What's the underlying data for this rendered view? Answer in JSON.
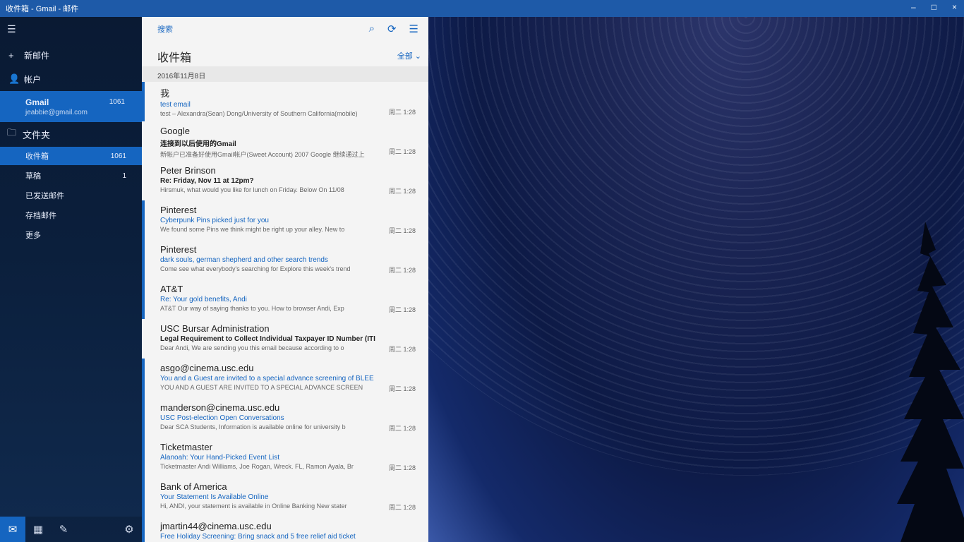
{
  "titlebar": {
    "title": "收件箱 - Gmail - 邮件",
    "controls": [
      "–",
      "□",
      "×"
    ]
  },
  "nav": {
    "menu_icon": "hamburger-icon",
    "new_mail": "新邮件",
    "accounts": "帐户",
    "account": {
      "name": "Gmail",
      "email": "jeabbie@gmail.com",
      "count": "1061"
    },
    "folders_header": "文件夹",
    "folders": [
      {
        "label": "收件箱",
        "count": "1061",
        "active": true
      },
      {
        "label": "草稿",
        "count": "1",
        "active": false
      },
      {
        "label": "已发送邮件",
        "count": "",
        "active": false
      },
      {
        "label": "存档邮件",
        "count": "",
        "active": false
      },
      {
        "label": "更多",
        "count": "",
        "active": false
      }
    ],
    "bottom_icons": [
      "mail-icon",
      "calendar-icon",
      "people-icon",
      "settings-icon"
    ]
  },
  "list": {
    "toolbar_label": "搜索",
    "title": "收件箱",
    "filter": "全部",
    "date_header": "2016年11月8日",
    "messages": [
      {
        "sender": "我",
        "subject": "test email",
        "preview": "test – Alexandra(Sean) Dong/University of Southern California(mobile)",
        "time": "周二 1:28",
        "unread": true
      },
      {
        "sender": "Google",
        "subject": "连接到以后使用的Gmail",
        "preview": "新帐户已准备好使用Gmail帐户(Sweet Account) 2007 Google 继续通过上",
        "time": "周二 1:28",
        "unread": false
      },
      {
        "sender": "Peter Brinson",
        "subject": "Re: Friday, Nov 11 at 12pm?",
        "preview": "Hirsmuk, what would you like for lunch on Friday. Below On 11/08",
        "time": "周二 1:28",
        "unread": false
      },
      {
        "sender": "Pinterest",
        "subject": "Cyberpunk Pins picked just for you",
        "preview": "We found some Pins we think might be right up your alley. New to",
        "time": "周二 1:28",
        "unread": true
      },
      {
        "sender": "Pinterest",
        "subject": "dark souls, german shepherd and other search trends",
        "preview": "Come see what everybody's searching for Explore this week's trend",
        "time": "周二 1:28",
        "unread": true
      },
      {
        "sender": "AT&T",
        "subject": "Re: Your gold benefits, Andi",
        "preview": "AT&T Our way of saying thanks to you. How to browser Andi, Exp",
        "time": "周二 1:28",
        "unread": true
      },
      {
        "sender": "USC Bursar Administration",
        "subject": "Legal Requirement to Collect Individual Taxpayer ID Number (ITIN",
        "preview": "Dear Andi, We are sending you this email because according to o",
        "time": "周二 1:28",
        "unread": false
      },
      {
        "sender": "asgo@cinema.usc.edu",
        "subject": "You and a Guest are invited to a special advance screening of BLEE",
        "preview": "YOU AND A GUEST ARE INVITED TO A SPECIAL ADVANCE SCREEN",
        "time": "周二 1:28",
        "unread": true
      },
      {
        "sender": "manderson@cinema.usc.edu",
        "subject": "USC Post-election Open Conversations",
        "preview": "Dear SCA Students, Information is available online for university b",
        "time": "周二 1:28",
        "unread": true
      },
      {
        "sender": "Ticketmaster",
        "subject": "Alanoah: Your Hand-Picked Event List",
        "preview": "Ticketmaster Andi Williams, Joe Rogan, Wreck. FL, Ramon Ayala, Br",
        "time": "周二 1:28",
        "unread": true
      },
      {
        "sender": "Bank of America",
        "subject": "Your Statement Is Available Online",
        "preview": "Hi, ANDI, your statement is available in Online Banking New stater",
        "time": "周二 1:28",
        "unread": true
      },
      {
        "sender": "jmartin44@cinema.usc.edu",
        "subject": "Free Holiday Screening: Bring snack and 5 free relief aid ticket",
        "preview": "",
        "time": "",
        "unread": true
      }
    ]
  },
  "colors": {
    "accent": "#1565c0",
    "titlebar": "#1e5aa8"
  }
}
